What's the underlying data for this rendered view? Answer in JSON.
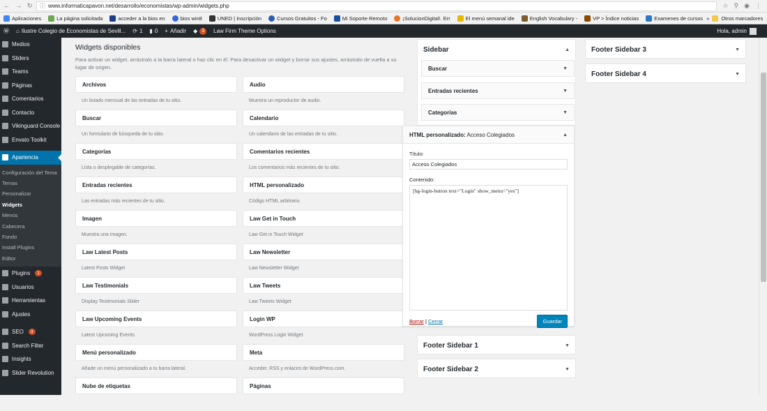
{
  "browser": {
    "url": "www.informaticapavon.net/desarrollo/economistas/wp-admin/widgets.php",
    "bookmarks": [
      "Aplicaciones",
      "La página solicitada",
      "acceder a la bios en",
      "bios win8",
      "UNED | Inscripción",
      "Cursos Gratuitos - Fo",
      "Mi Soporte Remoto",
      "¡SolucionDigital!. Err",
      "El menú semanal ide",
      "English Vocabulary -",
      "VP > Índice noticias",
      "Examenes de cursos"
    ],
    "other_bookmarks": "Otros marcadores"
  },
  "adminbar": {
    "site": "Ilustre Colegio de Economistas de Sevill...",
    "updates": "1",
    "comments": "0",
    "add": "Añadir",
    "badge": "3",
    "theme_options": "Law Firm Theme Options",
    "hello": "Hola, admin"
  },
  "sidebar": {
    "items_top": [
      {
        "label": "Medios",
        "icon": "media-icon"
      },
      {
        "label": "Sliders",
        "icon": "pin-icon"
      },
      {
        "label": "Teams",
        "icon": "pin-icon"
      },
      {
        "label": "Páginas",
        "icon": "page-icon"
      },
      {
        "label": "Comentarios",
        "icon": "comment-icon"
      },
      {
        "label": "Contacto",
        "icon": "mail-icon"
      },
      {
        "label": "Vikinguard Console",
        "icon": "gear-icon"
      },
      {
        "label": "Envato Toolkit",
        "icon": "leaf-icon"
      }
    ],
    "active": "Apariencia",
    "submenu": [
      "Configuración del Tema",
      "Temas",
      "Personalizar",
      "Widgets",
      "Menús",
      "Cabecera",
      "Fondo",
      "Install Plugins",
      "Editor"
    ],
    "items_bottom": [
      {
        "label": "Plugins",
        "badge": "1"
      },
      {
        "label": "Usuarios",
        "badge": ""
      },
      {
        "label": "Herramientas",
        "badge": ""
      },
      {
        "label": "Ajustes",
        "badge": ""
      }
    ],
    "items_extra": [
      {
        "label": "SEO",
        "badge": "3"
      },
      {
        "label": "Search Filter",
        "badge": ""
      },
      {
        "label": "Insights",
        "badge": ""
      },
      {
        "label": "Slider Revolution",
        "badge": ""
      }
    ]
  },
  "available": {
    "title": "Widgets disponibles",
    "description": "Para activar un widget, arrástralo a la barra lateral o haz clic en él. Para desactivar un widget y borrar sus ajustes, arrástralo de vuelta a su lugar de origen.",
    "widgets": [
      {
        "title": "Archivos",
        "desc": "Un listado mensual de las entradas de tu sitio."
      },
      {
        "title": "Audio",
        "desc": "Muestra un reproductor de audio."
      },
      {
        "title": "Buscar",
        "desc": "Un formulario de búsqueda de tu sitio."
      },
      {
        "title": "Calendario",
        "desc": "Un calendario de las entradas de tu sitio."
      },
      {
        "title": "Categorías",
        "desc": "Lista o desplegable de categorías."
      },
      {
        "title": "Comentarios recientes",
        "desc": "Los comentarios más recientes de tu sitio."
      },
      {
        "title": "Entradas recientes",
        "desc": "Las entradas más recientes de tu sitio."
      },
      {
        "title": "HTML personalizado",
        "desc": "Código HTML arbitrario."
      },
      {
        "title": "Imagen",
        "desc": "Muestra una imagen."
      },
      {
        "title": "Law Get in Touch",
        "desc": "Law Get in Touch Widget"
      },
      {
        "title": "Law Latest Posts",
        "desc": "Latest Posts Widget"
      },
      {
        "title": "Law Newsletter",
        "desc": "Law Newsletter Widget"
      },
      {
        "title": "Law Testimonials",
        "desc": "Display Testimonials Slider"
      },
      {
        "title": "Law Tweets",
        "desc": "Law Tweets Widget"
      },
      {
        "title": "Law Upcoming Events",
        "desc": "Latest Upcoming Events"
      },
      {
        "title": "Login WP",
        "desc": "WordPress Login Widget"
      },
      {
        "title": "Menú personalizado",
        "desc": "Añade un menú personalizado a tu barra lateral."
      },
      {
        "title": "Meta",
        "desc": "Acceder, RSS y enlaces de WordPress.com."
      },
      {
        "title": "Nube de etiquetas",
        "desc": ""
      },
      {
        "title": "Páginas",
        "desc": ""
      }
    ]
  },
  "sidebar_area": {
    "title": "Sidebar",
    "widgets": [
      "Buscar",
      "Entradas recientes",
      "Categorías"
    ]
  },
  "html_widget": {
    "header_type": "HTML personalizado:",
    "header_name": "Acceso Colegiados",
    "title_label": "Título:",
    "title_value": "Acceso Colegiados",
    "content_label": "Contenido:",
    "content_value": "[hg-login-button text=\"Login\" show_menu=\"yes\"]",
    "delete": "Borrar",
    "separator": "|",
    "close": "Cerrar",
    "save": "Guardar"
  },
  "footer_areas": {
    "f1": "Footer Sidebar 1",
    "f2": "Footer Sidebar 2",
    "f3": "Footer Sidebar 3",
    "f4": "Footer Sidebar 4"
  }
}
